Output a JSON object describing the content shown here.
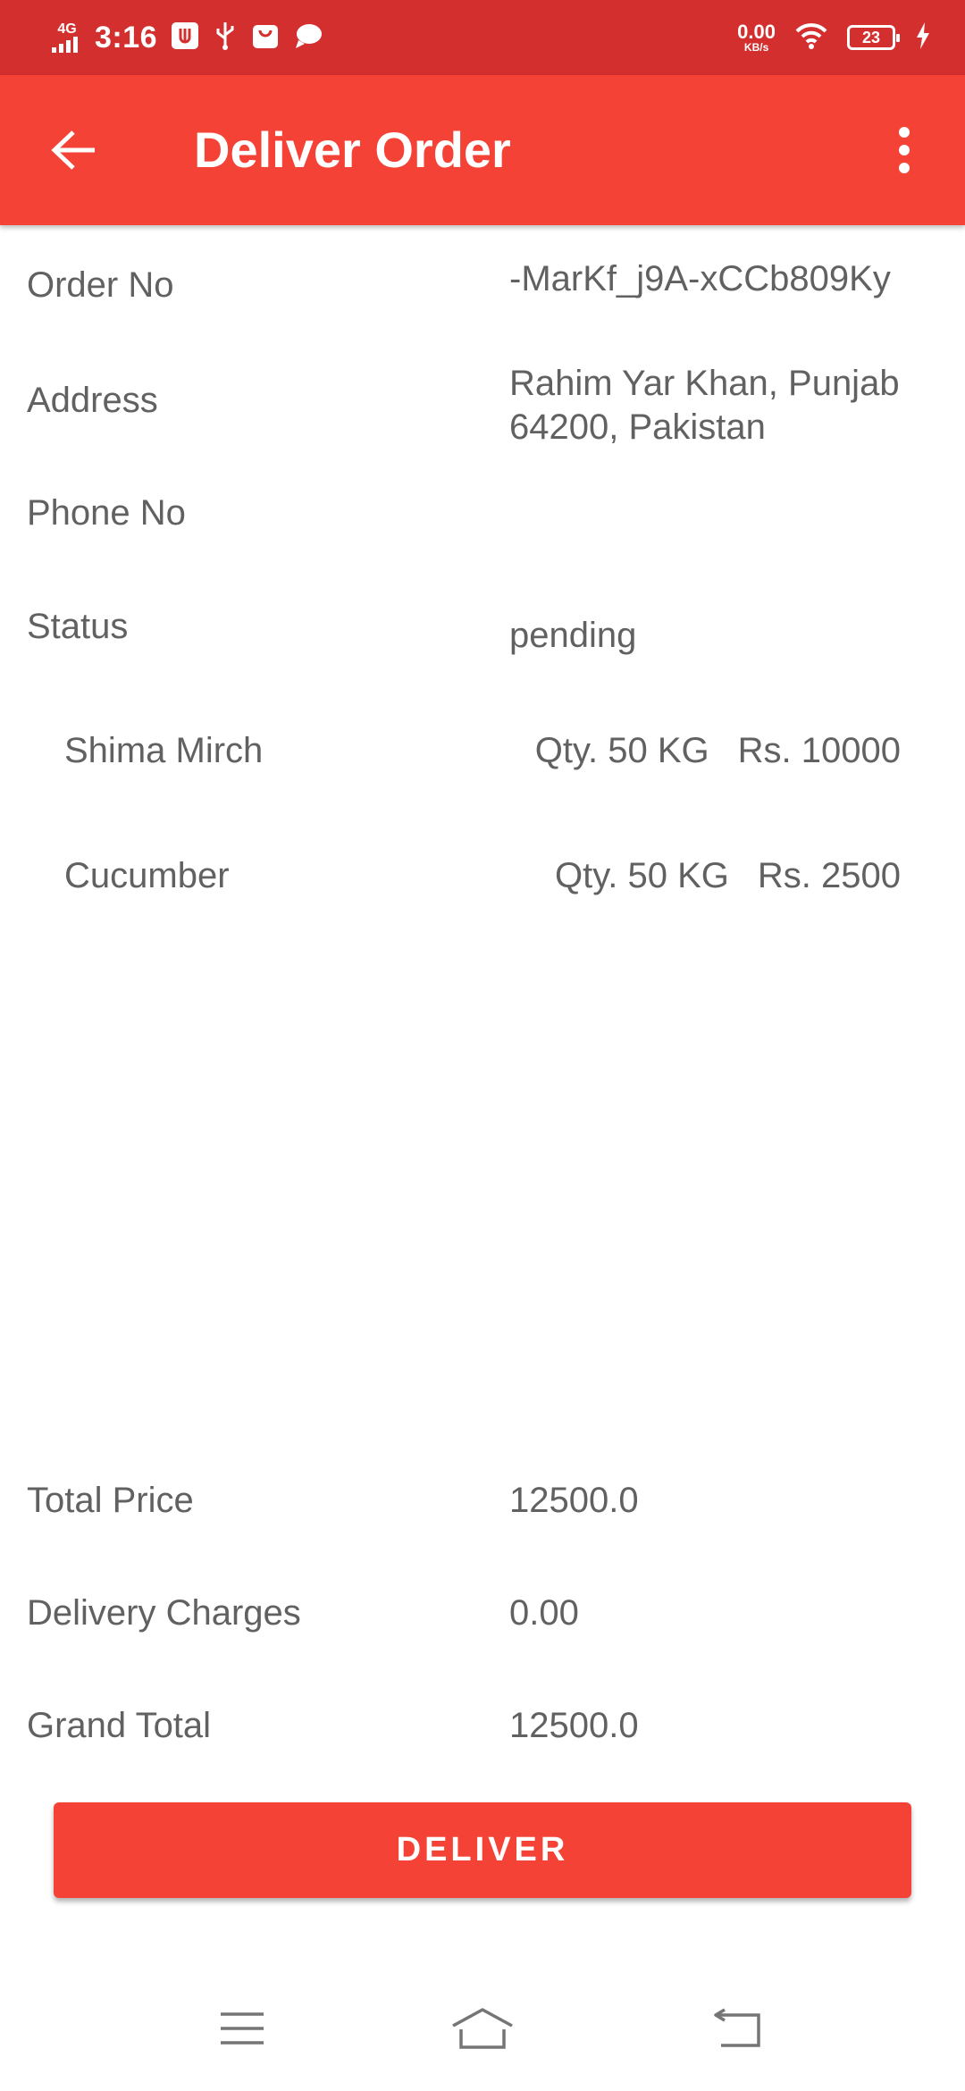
{
  "status_bar": {
    "network": "4G",
    "time": "3:16",
    "speed_value": "0.00",
    "speed_unit": "KB/s",
    "battery": "23"
  },
  "app_bar": {
    "title": "Deliver Order"
  },
  "details": {
    "order_no_label": "Order No",
    "order_no_value": "-MarKf_j9A-xCCb809Ky",
    "address_label": "Address",
    "address_value": "Rahim Yar Khan, Punjab 64200, Pakistan",
    "phone_label": "Phone No",
    "phone_value": "",
    "status_label": "Status",
    "status_value": "pending"
  },
  "items": [
    {
      "name": "Shima Mirch",
      "qty": "Qty. 50 KG",
      "price": "Rs. 10000"
    },
    {
      "name": "Cucumber",
      "qty": "Qty. 50 KG",
      "price": "Rs. 2500"
    }
  ],
  "totals": {
    "total_price_label": "Total Price",
    "total_price_value": "12500.0",
    "delivery_charges_label": "Delivery Charges",
    "delivery_charges_value": "0.00",
    "grand_total_label": "Grand Total",
    "grand_total_value": "12500.0"
  },
  "actions": {
    "deliver_label": "DELIVER"
  },
  "icons": {
    "back": "arrow-back-icon",
    "overflow": "more-vert-icon",
    "nav_menu": "menu-icon",
    "nav_home": "home-icon",
    "nav_back": "back-icon"
  },
  "colors": {
    "status_bar": "#d32f2f",
    "app_bar": "#f44336",
    "accent": "#f44336",
    "text": "#616161"
  }
}
